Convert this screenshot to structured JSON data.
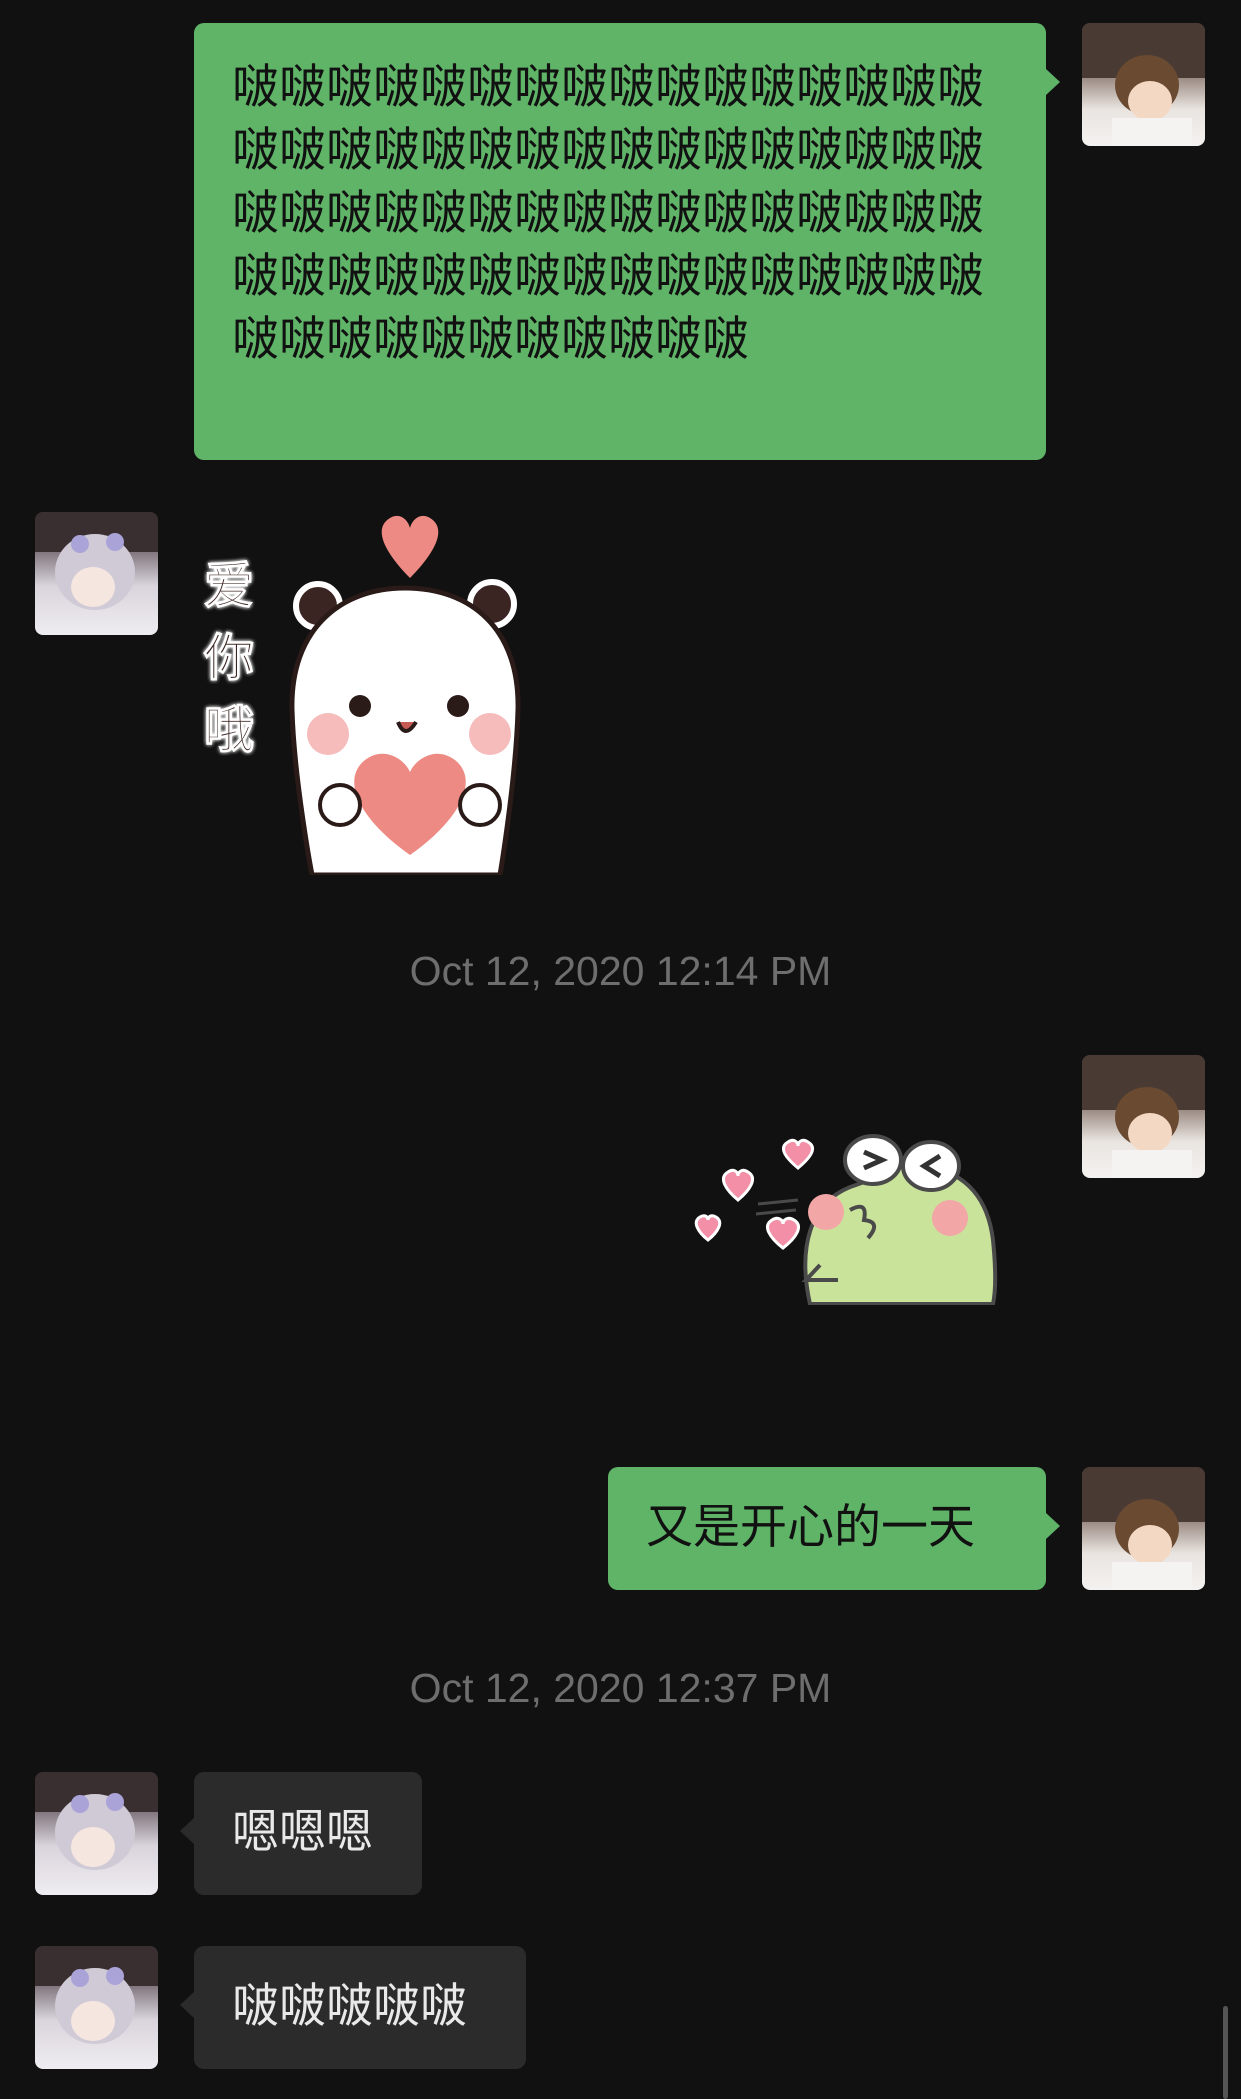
{
  "messages": [
    {
      "text": "啵啵啵啵啵啵啵啵啵啵啵啵啵啵啵啵啵啵啵啵啵啵啵啵啵啵啵啵啵啵啵啵啵啵啵啵啵啵啵啵啵啵啵啵啵啵啵啵啵啵啵啵啵啵啵啵啵啵啵啵啵啵啵啵啵啵啵啵啵啵啵啵啵啵啵"
    },
    {
      "sticker_text": "爱你哦"
    },
    {
      "text": "又是开心的一天"
    },
    {
      "text": "嗯嗯嗯"
    },
    {
      "text": "啵啵啵啵啵"
    }
  ],
  "timestamps": [
    "Oct 12, 2020 12:14 PM",
    "Oct 12, 2020 12:37 PM"
  ],
  "colors": {
    "background": "#111111",
    "my_bubble": "#5fb468",
    "their_bubble": "#2b2b2b",
    "timestamp": "#6e6e6e"
  }
}
